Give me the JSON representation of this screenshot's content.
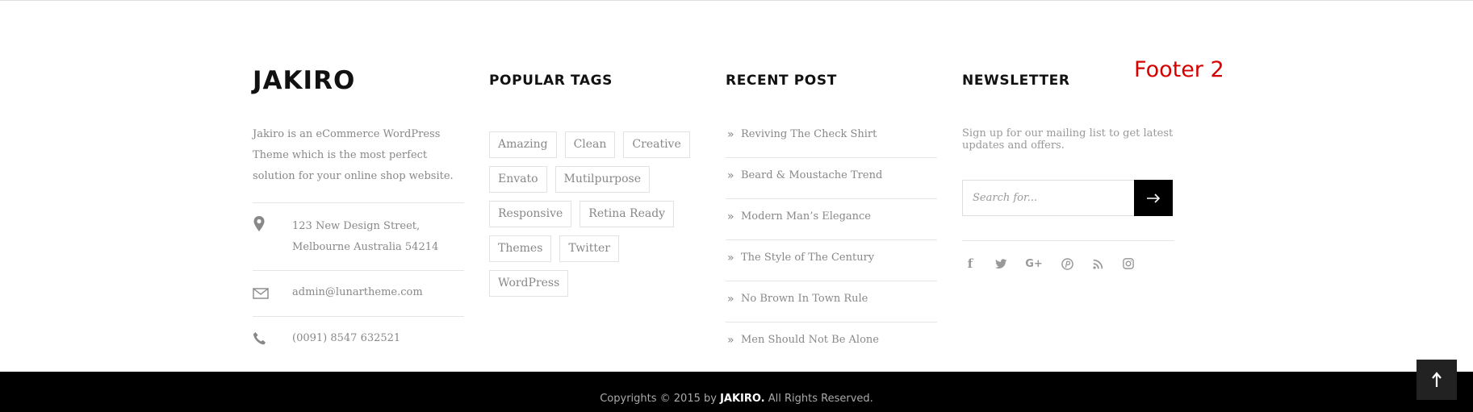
{
  "about": {
    "brand": "JAKIRO",
    "description": "Jakiro is an eCommerce WordPress Theme which is the most perfect solution for your online shop website.",
    "address_line1": "123 New Design Street,",
    "address_line2": "Melbourne Australia 54214",
    "email": "admin@lunartheme.com",
    "phone": "(0091) 8547 632521"
  },
  "tags": {
    "heading": "POPULAR TAGS",
    "items": [
      "Amazing",
      "Clean",
      "Creative",
      "Envato",
      "Mutilpurpose",
      "Responsive",
      "Retina Ready",
      "Themes",
      "Twitter",
      "WordPress"
    ]
  },
  "recent": {
    "heading": "RECENT POST",
    "bullet": "»",
    "posts": [
      "Reviving The Check Shirt",
      "Beard & Moustache Trend",
      "Modern Man’s Elegance",
      "The Style of The Century",
      "No Brown In Town Rule",
      "Men Should Not Be Alone"
    ]
  },
  "newsletter": {
    "heading": "NEWSLETTER",
    "description": "Sign up for our mailing list to get latest updates and offers.",
    "placeholder": "Search for...",
    "socials": [
      "facebook-icon",
      "twitter-icon",
      "google-plus-icon",
      "pinterest-icon",
      "rss-icon",
      "instagram-icon"
    ]
  },
  "annotation": "Footer 2",
  "copyright": {
    "prefix": "Copyrights © 2015 by ",
    "brand": "JAKIRO.",
    "suffix": " All Rights Reserved."
  },
  "colors": {
    "accent": "#000000",
    "annotation": "#d40000",
    "text": "#888888"
  }
}
